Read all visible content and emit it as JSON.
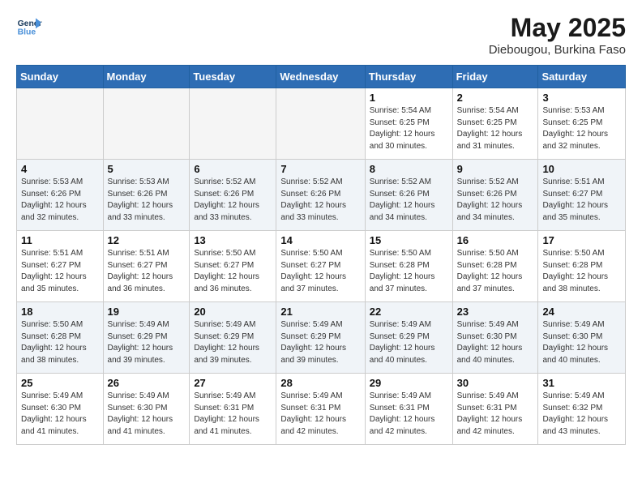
{
  "header": {
    "logo_line1": "General",
    "logo_line2": "Blue",
    "month_year": "May 2025",
    "location": "Diebougou, Burkina Faso"
  },
  "days_of_week": [
    "Sunday",
    "Monday",
    "Tuesday",
    "Wednesday",
    "Thursday",
    "Friday",
    "Saturday"
  ],
  "weeks": [
    [
      {
        "day": "",
        "info": ""
      },
      {
        "day": "",
        "info": ""
      },
      {
        "day": "",
        "info": ""
      },
      {
        "day": "",
        "info": ""
      },
      {
        "day": "1",
        "info": "Sunrise: 5:54 AM\nSunset: 6:25 PM\nDaylight: 12 hours\nand 30 minutes."
      },
      {
        "day": "2",
        "info": "Sunrise: 5:54 AM\nSunset: 6:25 PM\nDaylight: 12 hours\nand 31 minutes."
      },
      {
        "day": "3",
        "info": "Sunrise: 5:53 AM\nSunset: 6:25 PM\nDaylight: 12 hours\nand 32 minutes."
      }
    ],
    [
      {
        "day": "4",
        "info": "Sunrise: 5:53 AM\nSunset: 6:26 PM\nDaylight: 12 hours\nand 32 minutes."
      },
      {
        "day": "5",
        "info": "Sunrise: 5:53 AM\nSunset: 6:26 PM\nDaylight: 12 hours\nand 33 minutes."
      },
      {
        "day": "6",
        "info": "Sunrise: 5:52 AM\nSunset: 6:26 PM\nDaylight: 12 hours\nand 33 minutes."
      },
      {
        "day": "7",
        "info": "Sunrise: 5:52 AM\nSunset: 6:26 PM\nDaylight: 12 hours\nand 33 minutes."
      },
      {
        "day": "8",
        "info": "Sunrise: 5:52 AM\nSunset: 6:26 PM\nDaylight: 12 hours\nand 34 minutes."
      },
      {
        "day": "9",
        "info": "Sunrise: 5:52 AM\nSunset: 6:26 PM\nDaylight: 12 hours\nand 34 minutes."
      },
      {
        "day": "10",
        "info": "Sunrise: 5:51 AM\nSunset: 6:27 PM\nDaylight: 12 hours\nand 35 minutes."
      }
    ],
    [
      {
        "day": "11",
        "info": "Sunrise: 5:51 AM\nSunset: 6:27 PM\nDaylight: 12 hours\nand 35 minutes."
      },
      {
        "day": "12",
        "info": "Sunrise: 5:51 AM\nSunset: 6:27 PM\nDaylight: 12 hours\nand 36 minutes."
      },
      {
        "day": "13",
        "info": "Sunrise: 5:50 AM\nSunset: 6:27 PM\nDaylight: 12 hours\nand 36 minutes."
      },
      {
        "day": "14",
        "info": "Sunrise: 5:50 AM\nSunset: 6:27 PM\nDaylight: 12 hours\nand 37 minutes."
      },
      {
        "day": "15",
        "info": "Sunrise: 5:50 AM\nSunset: 6:28 PM\nDaylight: 12 hours\nand 37 minutes."
      },
      {
        "day": "16",
        "info": "Sunrise: 5:50 AM\nSunset: 6:28 PM\nDaylight: 12 hours\nand 37 minutes."
      },
      {
        "day": "17",
        "info": "Sunrise: 5:50 AM\nSunset: 6:28 PM\nDaylight: 12 hours\nand 38 minutes."
      }
    ],
    [
      {
        "day": "18",
        "info": "Sunrise: 5:50 AM\nSunset: 6:28 PM\nDaylight: 12 hours\nand 38 minutes."
      },
      {
        "day": "19",
        "info": "Sunrise: 5:49 AM\nSunset: 6:29 PM\nDaylight: 12 hours\nand 39 minutes."
      },
      {
        "day": "20",
        "info": "Sunrise: 5:49 AM\nSunset: 6:29 PM\nDaylight: 12 hours\nand 39 minutes."
      },
      {
        "day": "21",
        "info": "Sunrise: 5:49 AM\nSunset: 6:29 PM\nDaylight: 12 hours\nand 39 minutes."
      },
      {
        "day": "22",
        "info": "Sunrise: 5:49 AM\nSunset: 6:29 PM\nDaylight: 12 hours\nand 40 minutes."
      },
      {
        "day": "23",
        "info": "Sunrise: 5:49 AM\nSunset: 6:30 PM\nDaylight: 12 hours\nand 40 minutes."
      },
      {
        "day": "24",
        "info": "Sunrise: 5:49 AM\nSunset: 6:30 PM\nDaylight: 12 hours\nand 40 minutes."
      }
    ],
    [
      {
        "day": "25",
        "info": "Sunrise: 5:49 AM\nSunset: 6:30 PM\nDaylight: 12 hours\nand 41 minutes."
      },
      {
        "day": "26",
        "info": "Sunrise: 5:49 AM\nSunset: 6:30 PM\nDaylight: 12 hours\nand 41 minutes."
      },
      {
        "day": "27",
        "info": "Sunrise: 5:49 AM\nSunset: 6:31 PM\nDaylight: 12 hours\nand 41 minutes."
      },
      {
        "day": "28",
        "info": "Sunrise: 5:49 AM\nSunset: 6:31 PM\nDaylight: 12 hours\nand 42 minutes."
      },
      {
        "day": "29",
        "info": "Sunrise: 5:49 AM\nSunset: 6:31 PM\nDaylight: 12 hours\nand 42 minutes."
      },
      {
        "day": "30",
        "info": "Sunrise: 5:49 AM\nSunset: 6:31 PM\nDaylight: 12 hours\nand 42 minutes."
      },
      {
        "day": "31",
        "info": "Sunrise: 5:49 AM\nSunset: 6:32 PM\nDaylight: 12 hours\nand 43 minutes."
      }
    ]
  ]
}
